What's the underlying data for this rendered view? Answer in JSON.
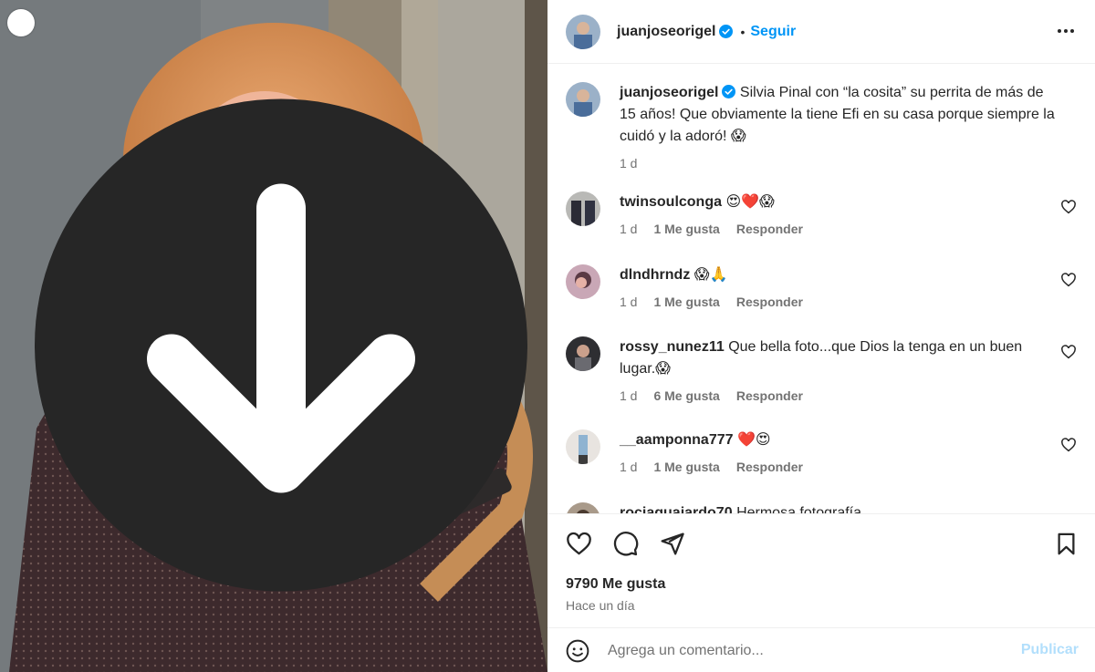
{
  "post": {
    "author": "juanjoseorigel",
    "follow_label": "Seguir",
    "dot": "•",
    "caption": "Silvia Pinal con “la cosita” su perrita de más de 15 años! Que obviamente la tiene Efi en su casa porque siempre la cuidó y la adoró! 😱",
    "caption_time": "1 d",
    "likes": "9790 Me gusta",
    "posted_ago": "Hace un día"
  },
  "comments": [
    {
      "user": "twinsoulconga",
      "text": "😍❤️😱",
      "time": "1 d",
      "likes": "1 Me gusta",
      "reply": "Responder"
    },
    {
      "user": "dlndhrndz",
      "text": "😱🙏",
      "time": "1 d",
      "likes": "1 Me gusta",
      "reply": "Responder"
    },
    {
      "user": "rossy_nunez11",
      "text": "Que bella foto...que Dios la tenga en un buen lugar.😱",
      "time": "1 d",
      "likes": "6 Me gusta",
      "reply": "Responder"
    },
    {
      "user": "__aamponna777",
      "text": "❤️😍",
      "time": "1 d",
      "likes": "1 Me gusta",
      "reply": "Responder"
    },
    {
      "user": "rociaguajardo70",
      "text": "Hermosa fotografía"
    }
  ],
  "comment_box": {
    "placeholder": "Agrega un comentario...",
    "publish_label": "Publicar"
  },
  "icons": {
    "download": "download-icon",
    "verified": "verified-badge-icon",
    "more": "more-options-icon",
    "like": "heart-icon",
    "comment": "comment-bubble-icon",
    "share": "paper-plane-icon",
    "save": "bookmark-icon",
    "emoji": "smiley-icon"
  },
  "colors": {
    "accent": "#0095f6",
    "publish_disabled": "#b2dffc",
    "secondary_text": "#737373",
    "verified": "#0095f6"
  }
}
